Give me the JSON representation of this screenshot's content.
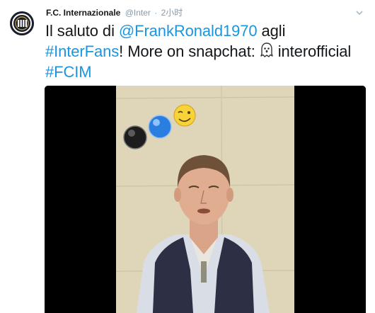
{
  "tweet": {
    "author_name": "F.C. Internazionale",
    "author_handle": "@Inter",
    "separator": "·",
    "timestamp": "2小时",
    "text_part1": "Il saluto di ",
    "mention": "@FrankRonald1970",
    "text_part2": " agli ",
    "hashtag1": "#InterFans",
    "text_part3": "! More on snapchat: ",
    "emoji": "ghost-emoji",
    "text_part4": " interofficial ",
    "hashtag2": "#FCIM"
  },
  "icons": {
    "avatar": "inter-crest-icon",
    "caret": "chevron-down-icon",
    "ghost": "ghost-icon"
  },
  "colors": {
    "link": "#1b95e0",
    "text": "#14171a",
    "meta": "#8899a6",
    "media_background": "#000000"
  }
}
